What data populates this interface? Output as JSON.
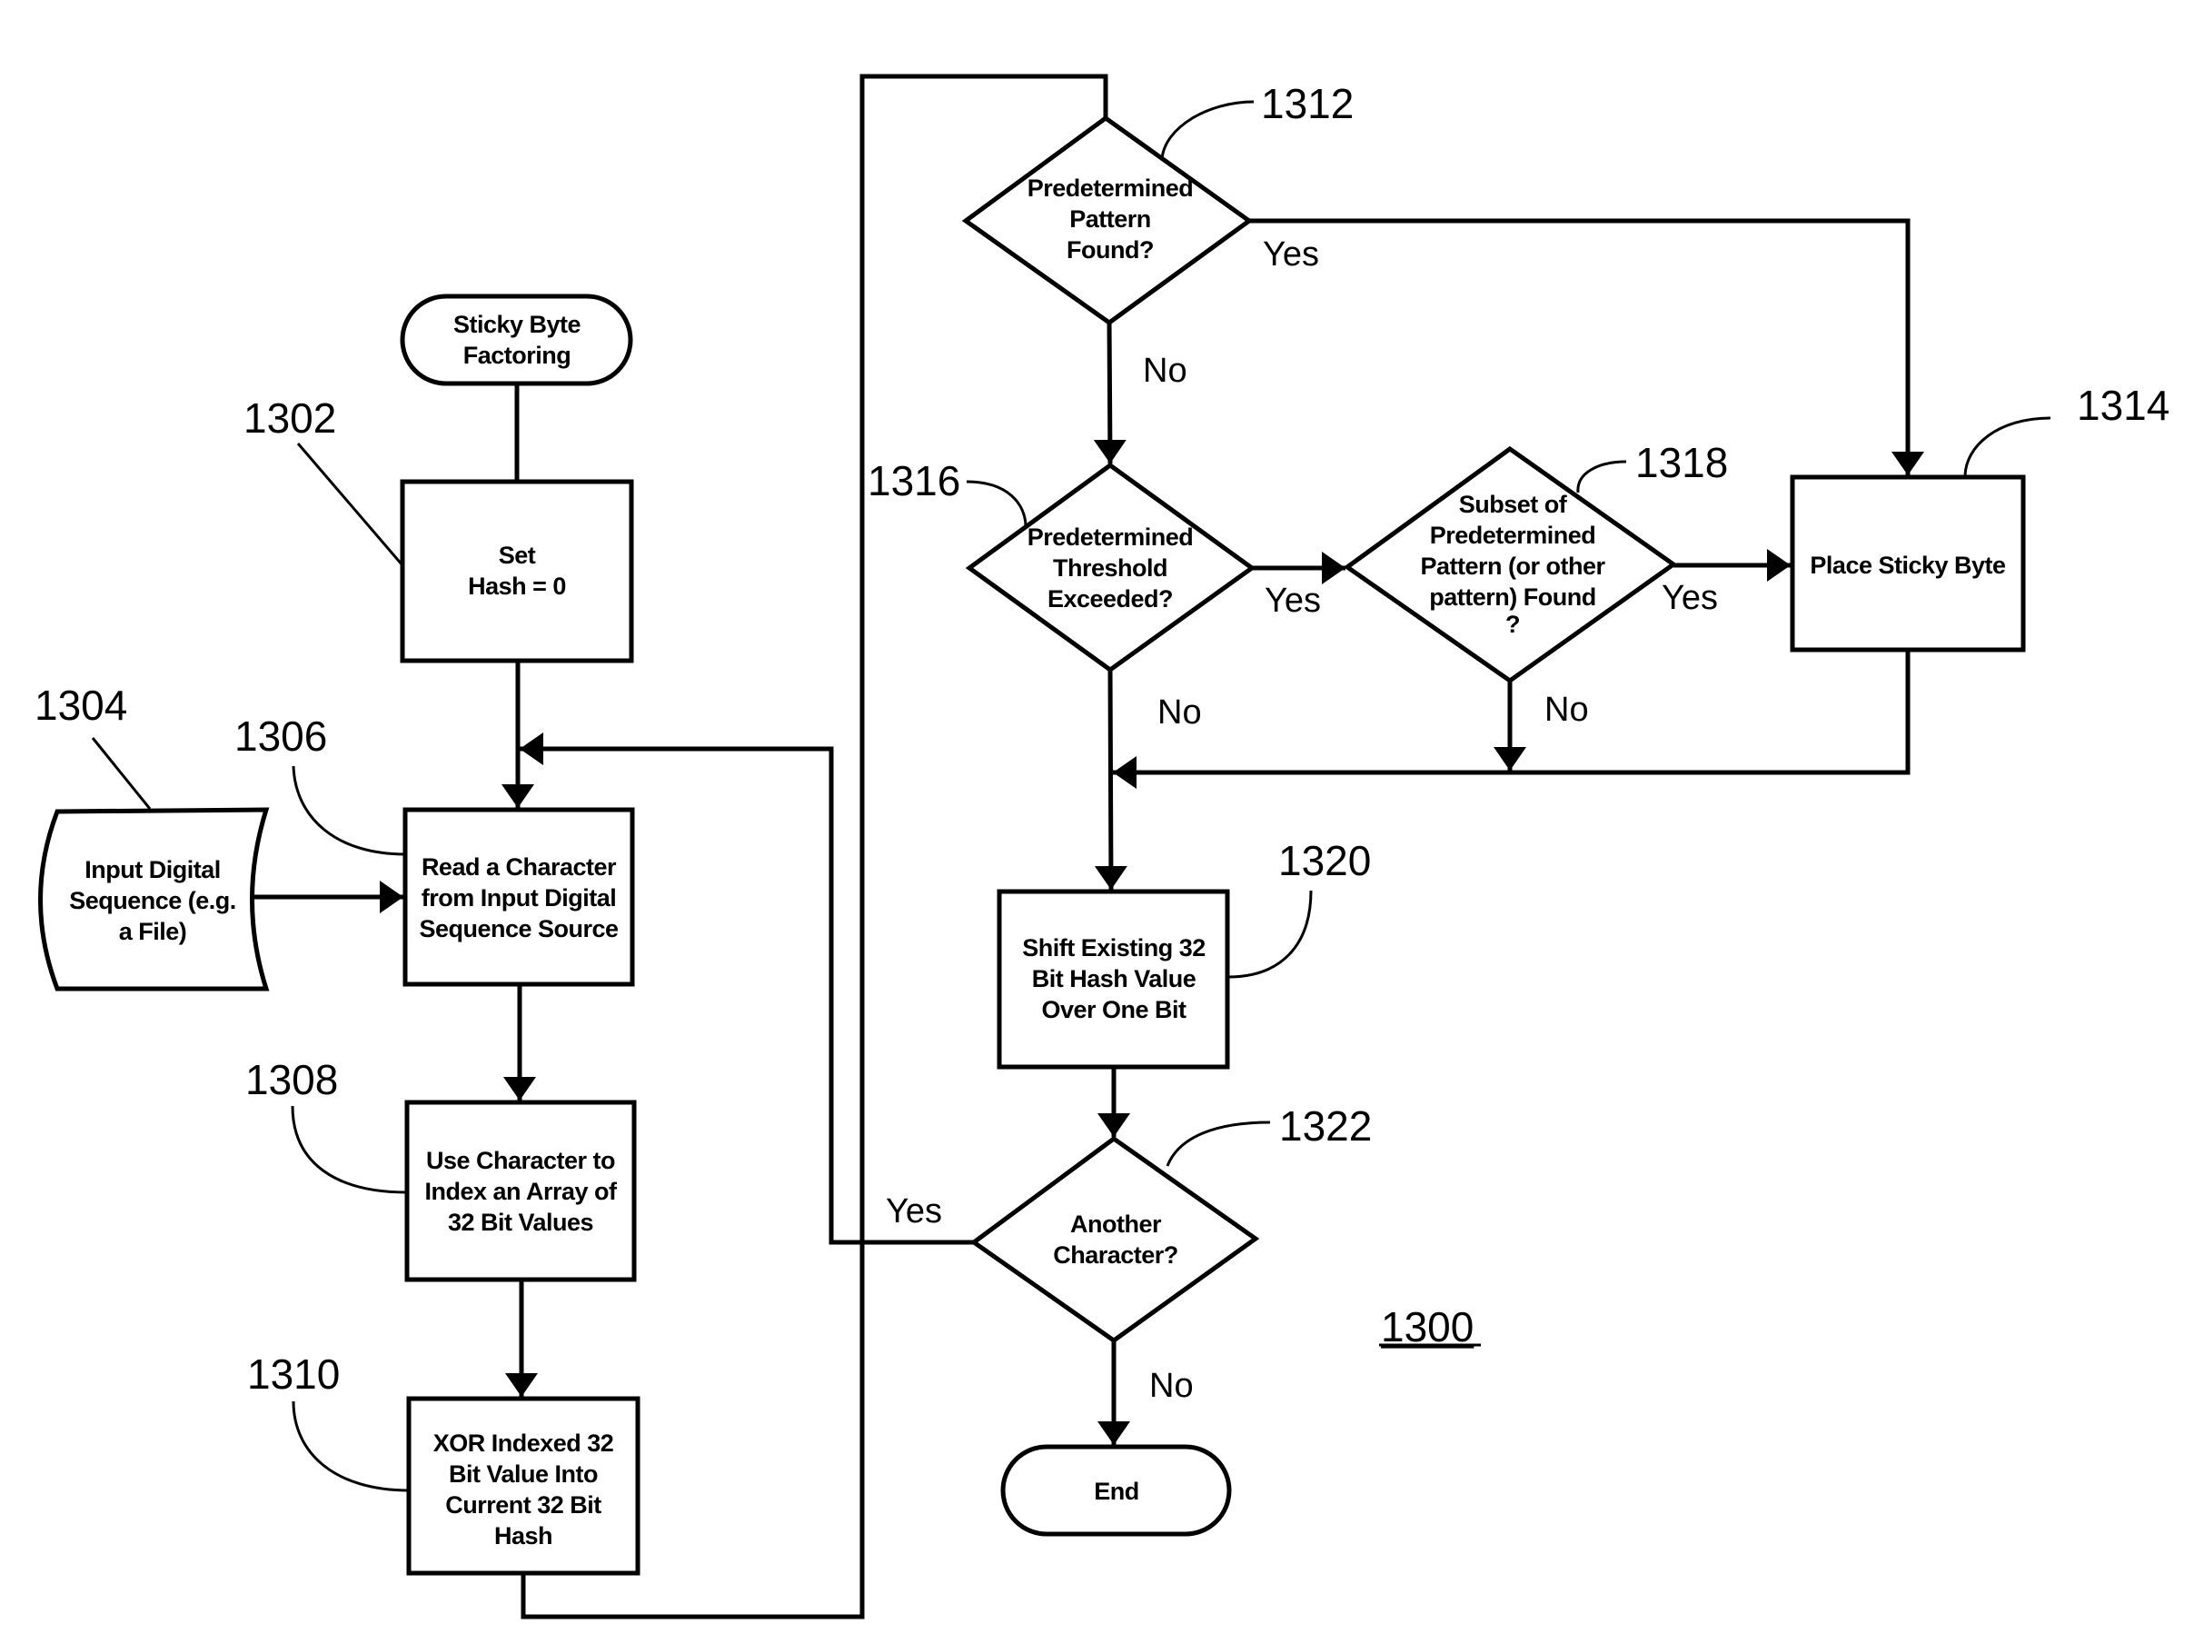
{
  "figure": {
    "number": "1300",
    "style": {
      "ink": "#000000",
      "paper": "#ffffff"
    }
  },
  "nodes": {
    "start": {
      "ref": "",
      "type": "terminal",
      "lines": [
        "Sticky Byte",
        "Factoring"
      ]
    },
    "n1302": {
      "ref": "1302",
      "type": "process",
      "lines": [
        "Set",
        "Hash = 0"
      ]
    },
    "n1304": {
      "ref": "1304",
      "type": "data-input",
      "lines": [
        "Input Digital",
        "Sequence (e.g.",
        "a File)"
      ]
    },
    "n1306": {
      "ref": "1306",
      "type": "process",
      "lines": [
        "Read a Character",
        "from Input Digital",
        "Sequence Source"
      ]
    },
    "n1308": {
      "ref": "1308",
      "type": "process",
      "lines": [
        "Use Character to",
        "Index an Array of",
        "32 Bit Values"
      ]
    },
    "n1310": {
      "ref": "1310",
      "type": "process",
      "lines": [
        "XOR Indexed 32",
        "Bit Value Into",
        "Current 32 Bit",
        "Hash"
      ]
    },
    "n1312": {
      "ref": "1312",
      "type": "decision",
      "lines": [
        "Predetermined",
        "Pattern",
        "Found?"
      ]
    },
    "n1314": {
      "ref": "1314",
      "type": "process",
      "lines": [
        "Place Sticky Byte"
      ]
    },
    "n1316": {
      "ref": "1316",
      "type": "decision",
      "lines": [
        "Predetermined",
        "Threshold",
        "Exceeded?"
      ]
    },
    "n1318": {
      "ref": "1318",
      "type": "decision",
      "lines": [
        "Subset of",
        "Predetermined",
        "Pattern (or other",
        "pattern) Found",
        "?"
      ]
    },
    "n1320": {
      "ref": "1320",
      "type": "process",
      "lines": [
        "Shift Existing 32",
        "Bit Hash Value",
        "Over One Bit"
      ]
    },
    "n1322": {
      "ref": "1322",
      "type": "decision",
      "lines": [
        "Another",
        "Character?"
      ]
    },
    "end": {
      "ref": "",
      "type": "terminal",
      "lines": [
        "End"
      ]
    }
  },
  "branch_labels": {
    "n1312_yes": "Yes",
    "n1312_no": "No",
    "n1316_yes": "Yes",
    "n1316_no": "No",
    "n1318_yes": "Yes",
    "n1318_no": "No",
    "n1322_yes": "Yes",
    "n1322_no": "No"
  }
}
